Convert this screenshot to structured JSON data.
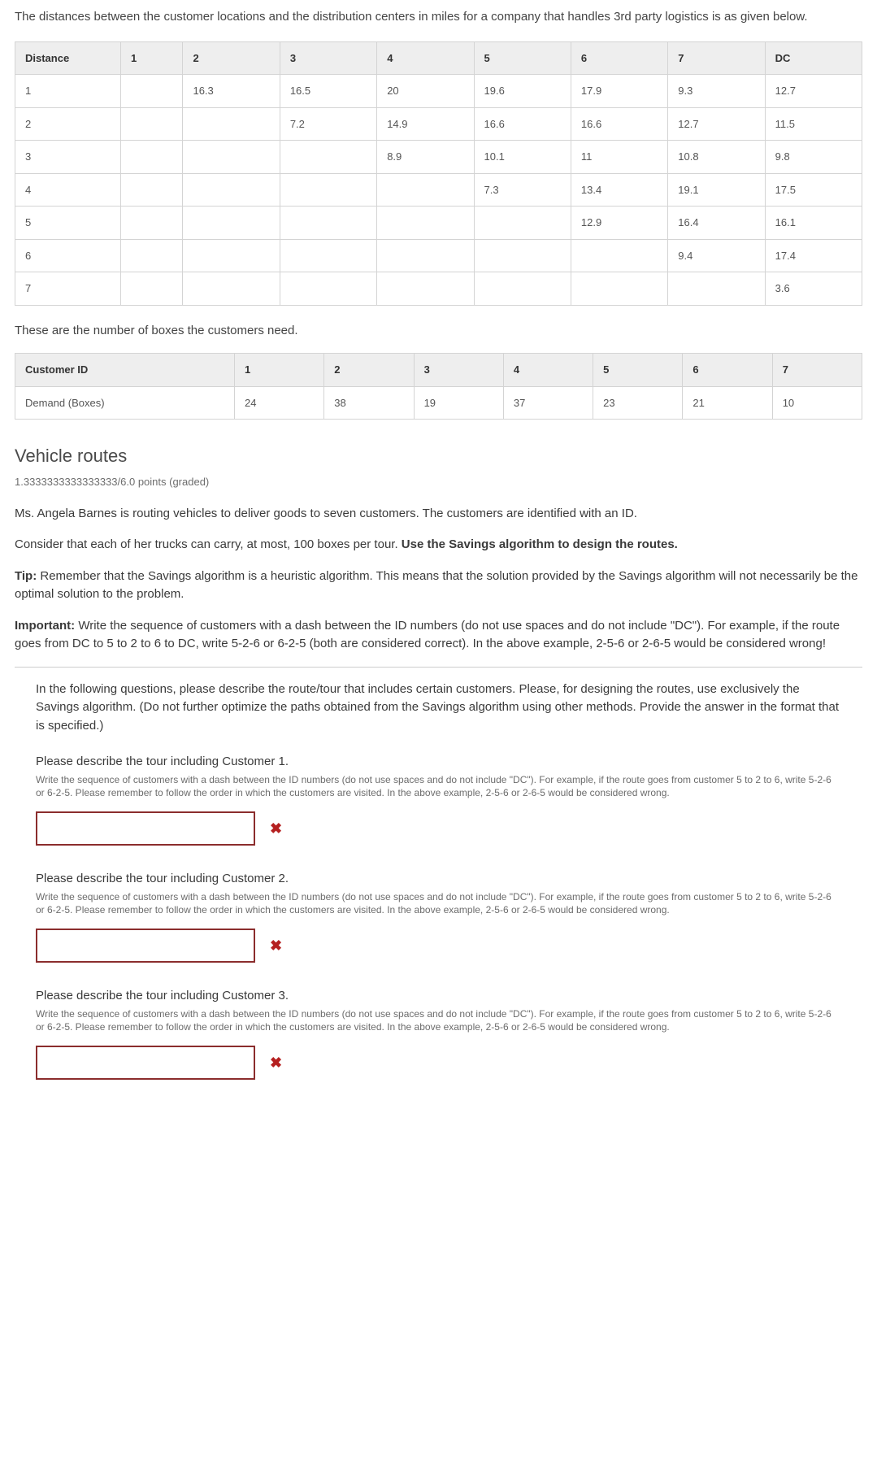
{
  "intro": "The distances between the customer locations and the distribution centers in miles for a company that handles 3rd party logistics is as given below.",
  "distanceTable": {
    "headers": [
      "Distance",
      "1",
      "2",
      "3",
      "4",
      "5",
      "6",
      "7",
      "DC"
    ],
    "rows": [
      [
        "1",
        "",
        "16.3",
        "16.5",
        "20",
        "19.6",
        "17.9",
        "9.3",
        "12.7"
      ],
      [
        "2",
        "",
        "",
        "7.2",
        "14.9",
        "16.6",
        "16.6",
        "12.7",
        "11.5"
      ],
      [
        "3",
        "",
        "",
        "",
        "8.9",
        "10.1",
        "11",
        "10.8",
        "9.8"
      ],
      [
        "4",
        "",
        "",
        "",
        "",
        "7.3",
        "13.4",
        "19.1",
        "17.5"
      ],
      [
        "5",
        "",
        "",
        "",
        "",
        "",
        "12.9",
        "16.4",
        "16.1"
      ],
      [
        "6",
        "",
        "",
        "",
        "",
        "",
        "",
        "9.4",
        "17.4"
      ],
      [
        "7",
        "",
        "",
        "",
        "",
        "",
        "",
        "",
        "3.6"
      ]
    ]
  },
  "boxesHeading": "These are the number of boxes the customers need.",
  "customerTable": {
    "headers": [
      "Customer ID",
      "1",
      "2",
      "3",
      "4",
      "5",
      "6",
      "7"
    ],
    "row": [
      "Demand (Boxes)",
      "24",
      "38",
      "19",
      "37",
      "23",
      "21",
      "10"
    ]
  },
  "section": {
    "title": "Vehicle routes",
    "points": "1.3333333333333333/6.0 points (graded)",
    "p1": "Ms. Angela Barnes is routing vehicles to deliver goods to seven customers. The customers are identified with an ID.",
    "p2a": "Consider that each of her trucks can carry, at most, 100 boxes per tour. ",
    "p2b": "Use the Savings algorithm to design the routes.",
    "p3a": "Tip:",
    "p3b": " Remember that the Savings algorithm is a heuristic algorithm. This means that the solution provided by the Savings algorithm will not necessarily be the optimal solution to the problem.",
    "p4a": "Important:",
    "p4b": " Write the sequence of customers with a dash between the ID numbers (do not use spaces and do not include \"DC\"). For example, if the route goes from DC to 5 to 2 to 6 to DC, write 5-2-6 or 6-2-5 (both are considered correct). In the above example, 2-5-6 or 2-6-5 would be considered wrong!"
  },
  "questions": {
    "intro": "In the following questions, please describe the route/tour that includes certain customers. Please, for designing the routes, use exclusively the Savings algorithm. (Do not further optimize the paths obtained from the Savings algorithm using other methods. Provide the answer in the format that is specified.)",
    "hint": "Write the sequence of customers with a dash between the ID numbers (do not use spaces and do not include \"DC\"). For example, if the route goes from customer 5 to 2 to 6, write 5-2-6 or 6-2-5. Please remember to follow the order in which the customers are visited. In the above example, 2-5-6 or 2-6-5 would be considered wrong.",
    "items": [
      {
        "title": "Please describe the tour including Customer 1."
      },
      {
        "title": "Please describe the tour including Customer 2."
      },
      {
        "title": "Please describe the tour including Customer 3."
      }
    ]
  }
}
